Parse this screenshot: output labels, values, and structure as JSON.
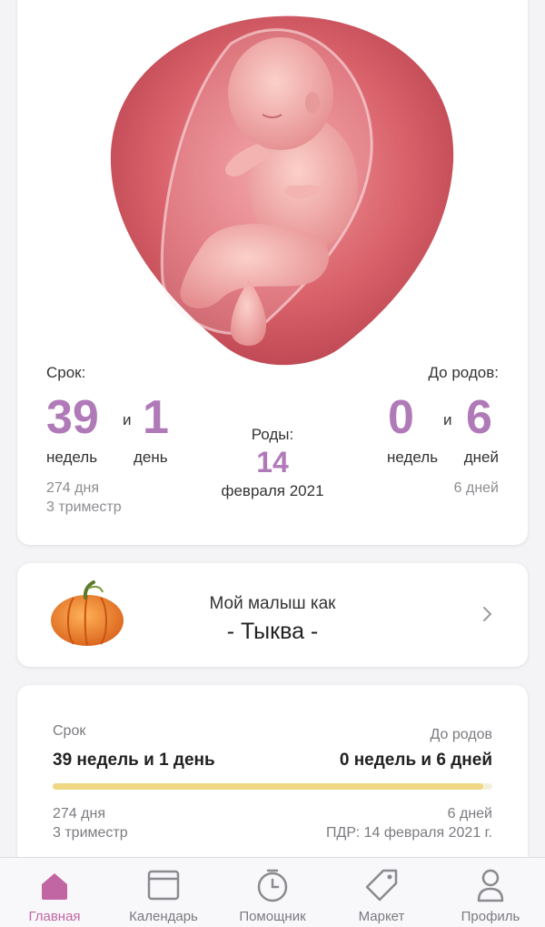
{
  "term": {
    "label": "Срок:",
    "weeks": "39",
    "conj": "и",
    "days": "1",
    "weeks_unit": "недель",
    "days_unit": "день",
    "total_days": "274 дня",
    "trimester": "3 триместр"
  },
  "birth": {
    "label": "Роды:",
    "day": "14",
    "month_year": "февраля 2021"
  },
  "until": {
    "label": "До родов:",
    "weeks": "0",
    "conj": "и",
    "days": "6",
    "weeks_unit": "недель",
    "days_unit": "дней",
    "total_days": "6 дней"
  },
  "fruit": {
    "caption": "Мой малыш как",
    "name": "- Тыква -"
  },
  "progress_card": {
    "term_label": "Срок",
    "term_value": "39 недель и 1 день",
    "until_label": "До родов",
    "until_value": "0 недель и 6 дней",
    "progress_fraction": 0.98,
    "left_days": "274 дня",
    "left_trimester": "3 триместр",
    "right_days": "6 дней",
    "due_date": "ПДР: 14 февраля 2021 г."
  },
  "nav": {
    "items": [
      {
        "label": "Главная",
        "icon": "home-icon",
        "active": true
      },
      {
        "label": "Календарь",
        "icon": "calendar-icon",
        "active": false
      },
      {
        "label": "Помощник",
        "icon": "timer-icon",
        "active": false
      },
      {
        "label": "Маркет",
        "icon": "tag-icon",
        "active": false
      },
      {
        "label": "Профиль",
        "icon": "profile-icon",
        "active": false
      }
    ]
  },
  "colors": {
    "accent": "#b07ab8",
    "nav_active": "#c266a3",
    "progress": "#f0d783"
  }
}
